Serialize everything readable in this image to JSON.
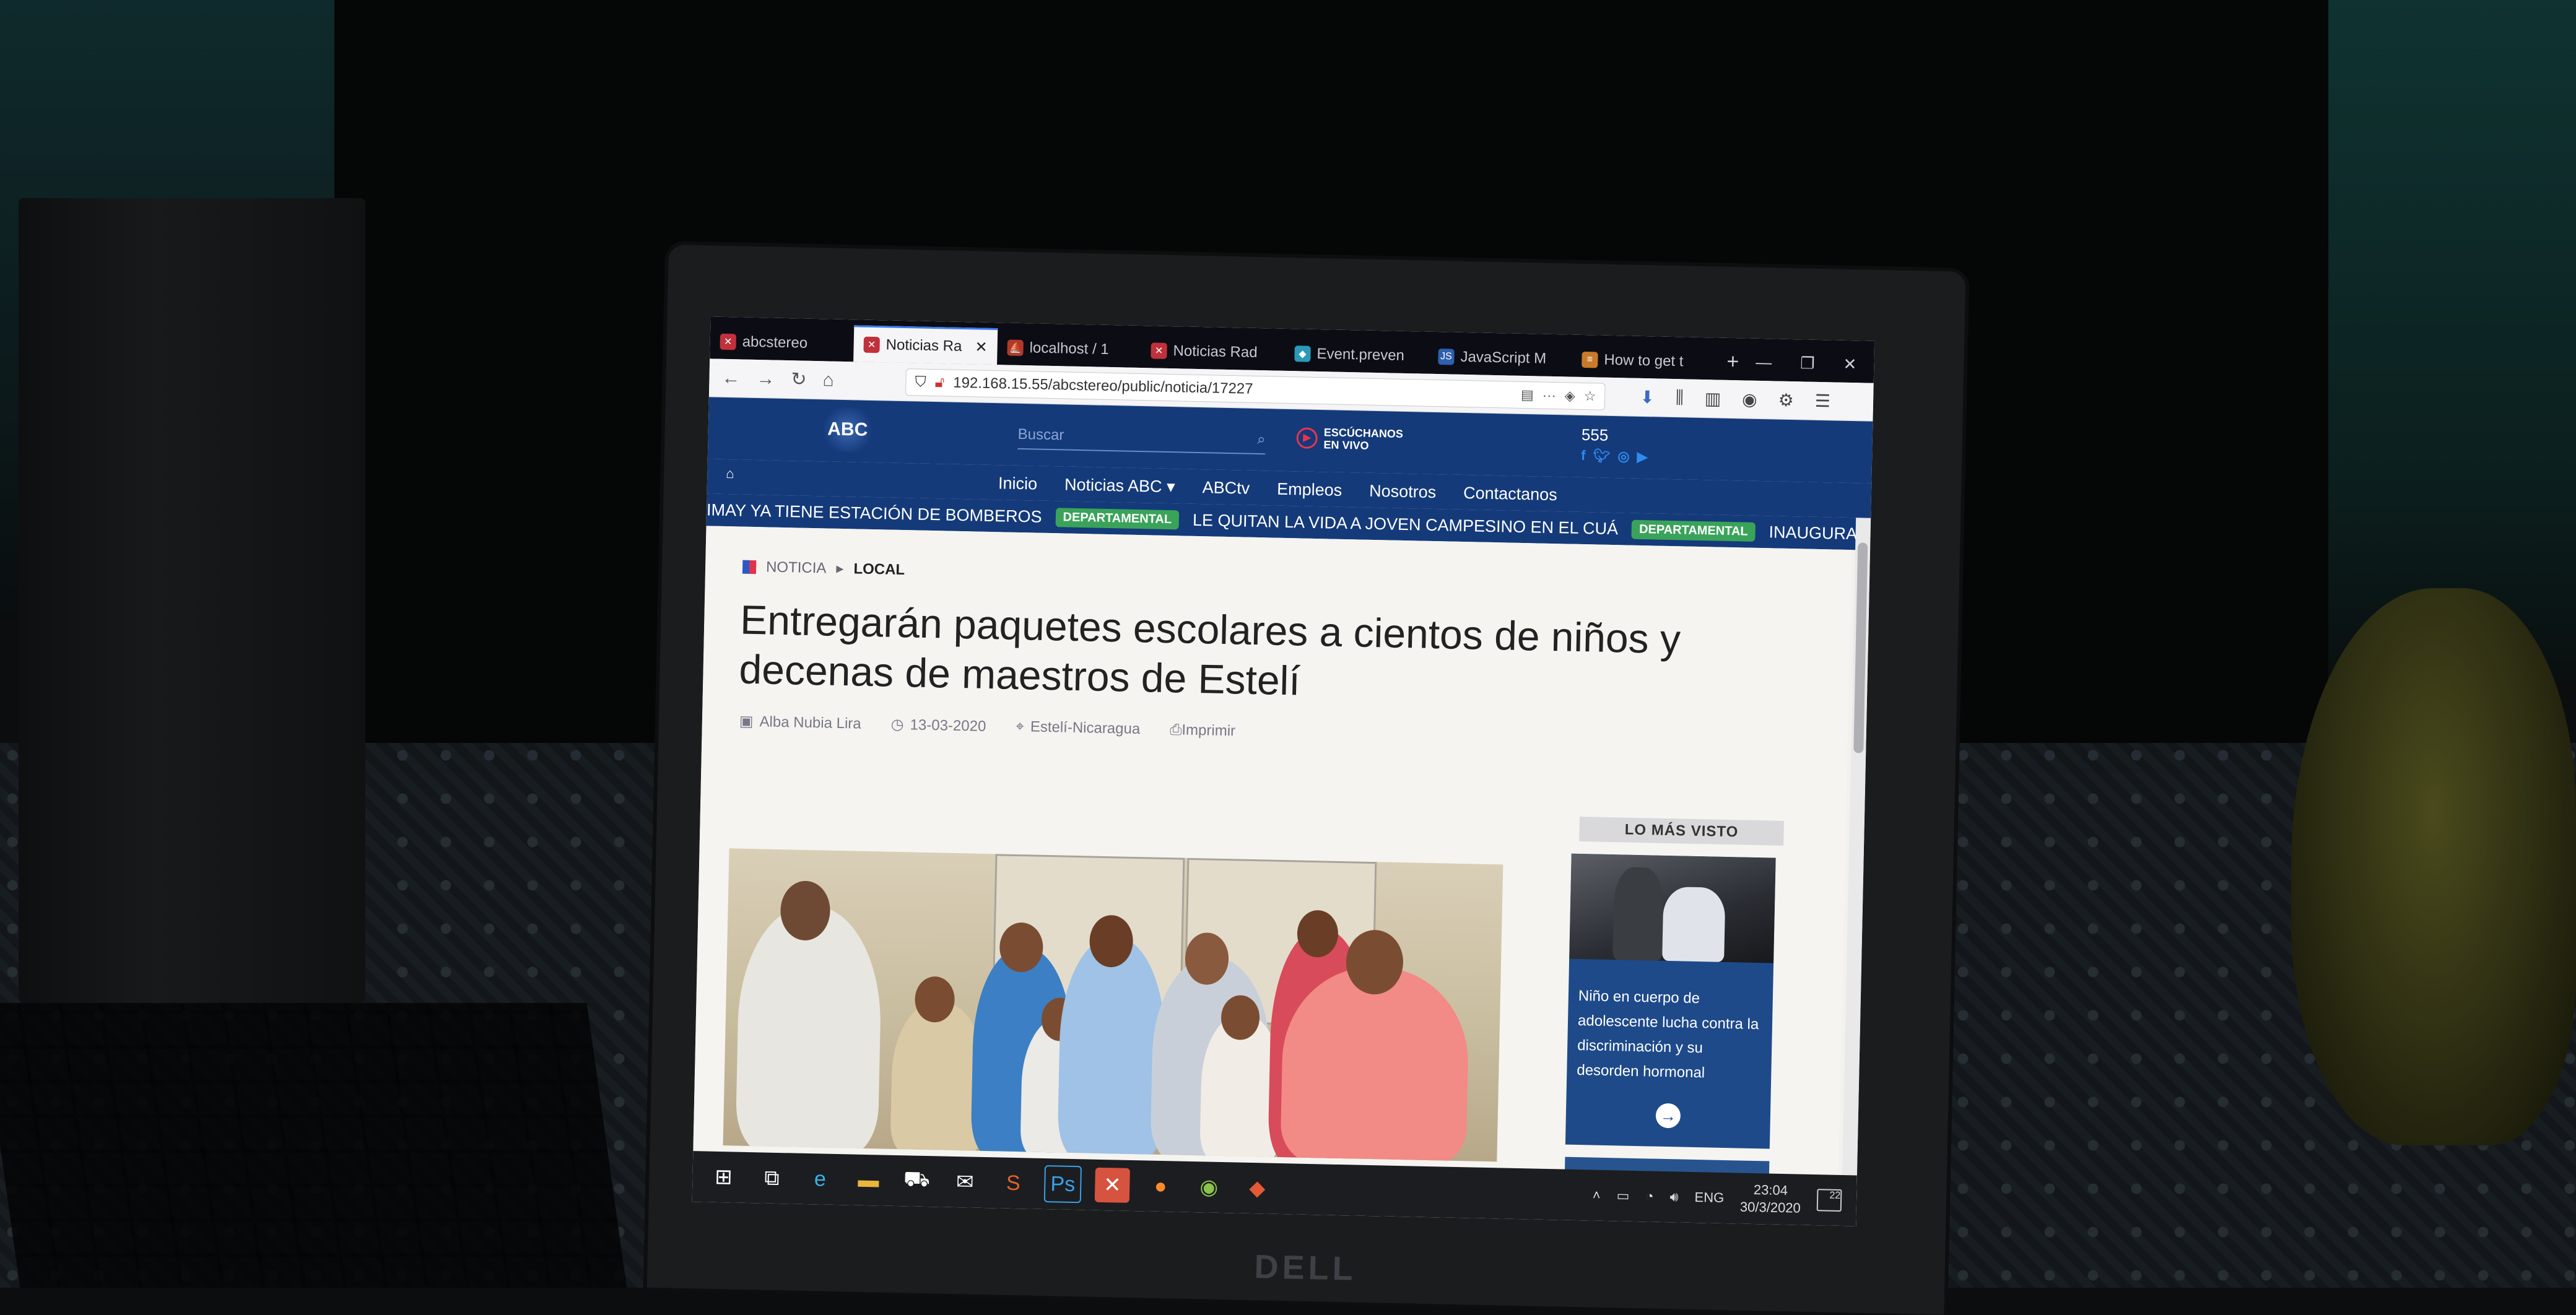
{
  "browser": {
    "tabs": [
      {
        "label": "abcstereo",
        "active": false
      },
      {
        "label": "Noticias Ra",
        "active": true
      },
      {
        "label": "localhost / 1",
        "active": false
      },
      {
        "label": "Noticias Rad",
        "active": false
      },
      {
        "label": "Event.preven",
        "active": false
      },
      {
        "label": "JavaScript M",
        "active": false
      },
      {
        "label": "How to get t",
        "active": false
      }
    ],
    "url": "192.168.15.55/abcstereo/public/noticia/17227"
  },
  "site": {
    "logo_text": "ABC",
    "search_placeholder": "Buscar",
    "listen_line1": "ESCÚCHANOS",
    "listen_line2": "EN VIVO",
    "phone": "555",
    "menu": [
      "Inicio",
      "Noticias ABC",
      "ABCtv",
      "Empleos",
      "Nosotros",
      "Contactanos"
    ],
    "ticker": [
      {
        "text": "IMAY YA TIENE ESTACIÓN DE BOMBEROS"
      },
      {
        "badge": "DEPARTAMENTAL"
      },
      {
        "text": "LE QUITAN LA VIDA A JOVEN CAMPESINO EN EL CUÁ"
      },
      {
        "badge": "DEPARTAMENTAL"
      },
      {
        "text": "INAUGURAN PROYECT"
      }
    ]
  },
  "article": {
    "breadcrumb_section": "NOTICIA",
    "breadcrumb_category": "LOCAL",
    "title": "Entregarán paquetes escolares a cientos de niños y decenas de maestros de Estelí",
    "author": "Alba Nubia Lira",
    "date": "13-03-2020",
    "location": "Estelí-Nicaragua",
    "print": "Imprimir"
  },
  "sidebar": {
    "heading": "LO MÁS VISTO",
    "card_text": "Niño en cuerpo de adolescente lucha contra la discriminación y su desorden hormonal"
  },
  "taskbar": {
    "language": "ENG",
    "time": "23:04",
    "date": "30/3/2020",
    "notifications": "22"
  },
  "device": {
    "brand": "DELL"
  },
  "colors": {
    "site_blue": "#143a7a",
    "badge_green": "#3aa35a",
    "accent_red": "#e9334f"
  }
}
